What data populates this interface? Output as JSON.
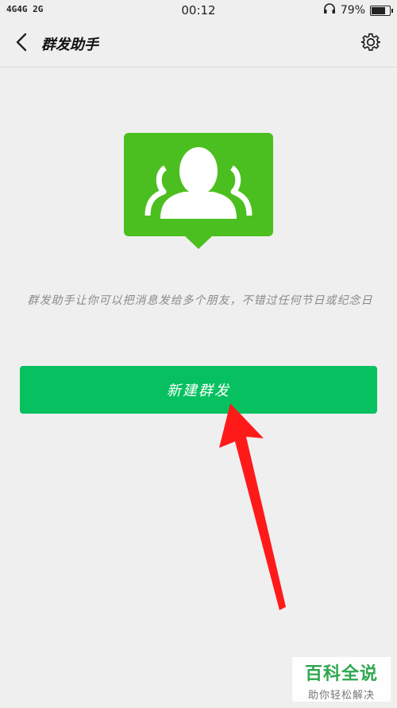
{
  "status_bar": {
    "signal": "4G4G 2G",
    "time": "00:12",
    "battery_text": "79%",
    "battery_level": 0.79,
    "headset_icon": "headset-icon"
  },
  "nav": {
    "back_icon": "chevron-left-icon",
    "title": "群发助手",
    "settings_icon": "gear-icon"
  },
  "hero": {
    "icon": "group-users-icon",
    "color": "#4cbf20"
  },
  "description": "群发助手让你可以把消息发给多个朋友，不错过任何节日或纪念日",
  "new_button": {
    "label": "新建群发",
    "color": "#07c160"
  },
  "annotation": {
    "icon": "red-arrow-icon",
    "color": "#ff1a1a"
  },
  "watermark": {
    "title": "百科全说",
    "subtitle": "助你轻松解决"
  }
}
